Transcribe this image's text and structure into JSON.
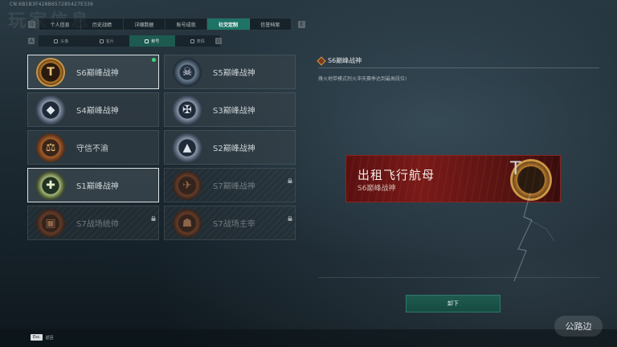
{
  "header": {
    "uid": "CN:6B1B3F428B657285427E336",
    "background_title": "玩家信息"
  },
  "main_tabs": {
    "key_left": "Q",
    "key_right": "E",
    "items": [
      {
        "label": "个人信息",
        "active": false
      },
      {
        "label": "历史战绩",
        "active": false
      },
      {
        "label": "详细数据",
        "active": false
      },
      {
        "label": "账号成就",
        "active": false
      },
      {
        "label": "社交定制",
        "active": true
      },
      {
        "label": "信誉档案",
        "active": false
      }
    ]
  },
  "sub_tabs": {
    "key_left": "A",
    "key_right": "D",
    "items": [
      {
        "label": "头像",
        "active": false
      },
      {
        "label": "名片",
        "active": false
      },
      {
        "label": "称号",
        "active": true
      },
      {
        "label": "表情",
        "active": false
      }
    ]
  },
  "medals": [
    {
      "label": "S6巅峰战神",
      "style": "m-gold",
      "glyph": "T",
      "selected": true,
      "equipped": true,
      "locked": false
    },
    {
      "label": "S5巅峰战神",
      "style": "m-dark",
      "glyph": "☠",
      "selected": false,
      "equipped": false,
      "locked": false
    },
    {
      "label": "S4巅峰战神",
      "style": "m-silver",
      "glyph": "◆",
      "selected": false,
      "equipped": false,
      "locked": false
    },
    {
      "label": "S3巅峰战神",
      "style": "m-silver",
      "glyph": "✠",
      "selected": false,
      "equipped": false,
      "locked": false
    },
    {
      "label": "守信不渝",
      "style": "m-bronze",
      "glyph": "⚖",
      "selected": false,
      "equipped": false,
      "locked": false
    },
    {
      "label": "S2巅峰战神",
      "style": "m-silver",
      "glyph": "▲",
      "selected": false,
      "equipped": false,
      "locked": false
    },
    {
      "label": "S1巅峰战神",
      "style": "m-green",
      "glyph": "✚",
      "selected": true,
      "equipped": false,
      "locked": false
    },
    {
      "label": "S7巅峰战神",
      "style": "m-locked",
      "glyph": "✈",
      "selected": false,
      "equipped": false,
      "locked": true
    },
    {
      "label": "S7战场统帅",
      "style": "m-locked",
      "glyph": "▣",
      "selected": false,
      "equipped": false,
      "locked": true
    },
    {
      "label": "S7战场主宰",
      "style": "m-locked",
      "glyph": "☗",
      "selected": false,
      "equipped": false,
      "locked": true
    }
  ],
  "detail": {
    "title": "S6巅峰战神",
    "description": "烽火地带模式烈火冲天赛季达到最高段位!",
    "banner_name": "出租飞行航母",
    "banner_title": "S6巅峰战神",
    "banner_glyph": "T",
    "equip_label": "卸下"
  },
  "footer": {
    "esc_key": "Esc",
    "esc_label": "返回",
    "watermark": "公路边"
  },
  "colors": {
    "accent": "#1e7366",
    "banner": "#7a1a18",
    "equipped_dot": "#3fd47d"
  }
}
